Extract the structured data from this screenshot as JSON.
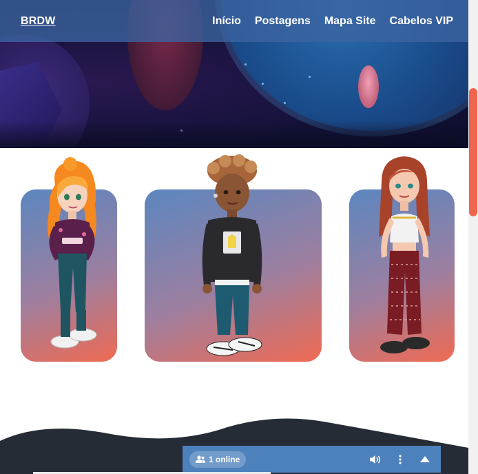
{
  "header": {
    "brand": "BRDW",
    "nav": [
      {
        "label": "Início"
      },
      {
        "label": "Postagens"
      },
      {
        "label": "Mapa Site"
      },
      {
        "label": "Cabelos VIP"
      }
    ]
  },
  "characters": [
    {
      "name": "avatar-orange-hair-girl"
    },
    {
      "name": "avatar-curly-hair-boy"
    },
    {
      "name": "avatar-red-hair-girl"
    }
  ],
  "online_bar": {
    "count_label": "1 online",
    "icons": {
      "users": "users-icon",
      "volume": "volume-icon",
      "menu": "more-vertical-icon",
      "collapse": "chevron-up-icon"
    }
  },
  "colors": {
    "navbar": "#3c64a0",
    "accent": "#f0654e",
    "card_gradient_start": "#5b86bf",
    "card_gradient_end": "#f06a52",
    "footer_wave": "#262c35",
    "online_bar": "#4d81bc"
  }
}
